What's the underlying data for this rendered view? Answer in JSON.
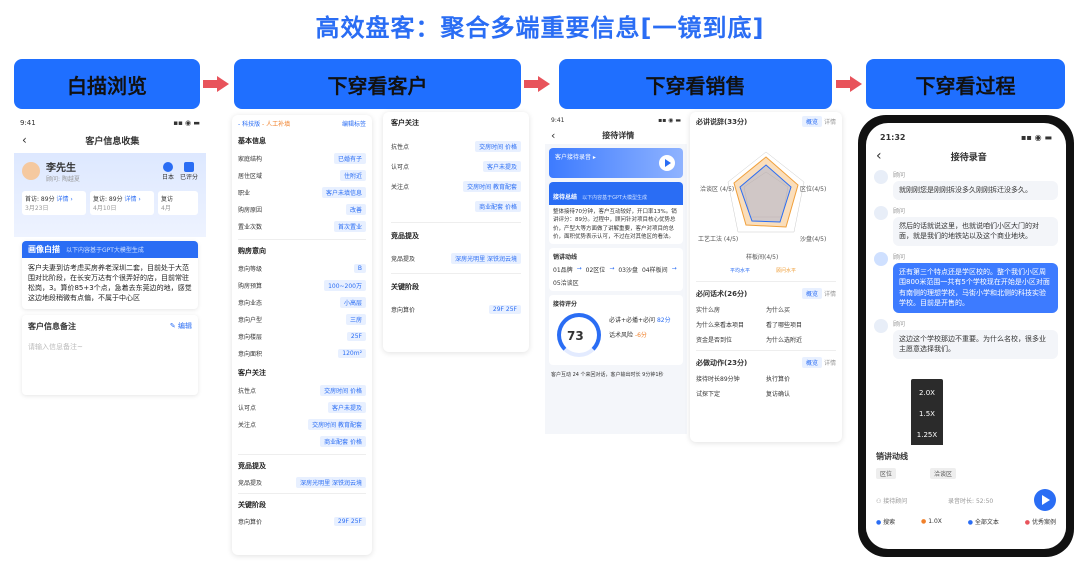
{
  "title": "高效盘客：聚合多端重要信息[一镜到底]",
  "stages": [
    "白描浏览",
    "下穿看客户",
    "下穿看销售",
    "下穿看过程"
  ],
  "p1": {
    "time": "9:41",
    "header": "客户信息收集",
    "name": "李先生",
    "role": "顾问: 陶越夏",
    "schedule": "日本",
    "icon2": "已评分",
    "visits": [
      {
        "label": "首访: 89分",
        "date": "3月23日",
        "detail": "详情 ›"
      },
      {
        "label": "复访: 89分",
        "date": "4月10日",
        "detail": "详情 ›"
      },
      {
        "label": "复访",
        "date": "4月"
      }
    ],
    "portrait_title": "画像白描",
    "portrait_sub": "以下内容基于GPT大模型生成",
    "portrait_text": "客户夫妻到访考虑买房养老深圳二套，目前处于大范围对比阶段，在长安万达有个很弄好的店，目前常驻松岗，3。算价85+3个点，急着去东莞边的地，感觉这边地段稍微有点偏，不属于中心区",
    "remark_title": "客户信息备注",
    "remark_edit": "编辑",
    "remark_ph": "请输入信息备注~"
  },
  "p2": {
    "legend": [
      "- 科技版",
      "- 人工补填"
    ],
    "edit": "编辑标签",
    "basic": "基本信息",
    "rows1": [
      [
        "家庭结构",
        "已婚有子"
      ],
      [
        "居住区域",
        "住附近"
      ],
      [
        "职业",
        "客户未填信息"
      ],
      [
        "购房原因",
        "改善"
      ],
      [
        "置业次数",
        "首次置业"
      ]
    ],
    "intent": "购房意向",
    "rows2": [
      [
        "意向等级",
        "B"
      ],
      [
        "购房预算",
        "100~200万"
      ],
      [
        "意向业态",
        "小高层"
      ],
      [
        "意向户型",
        "三房"
      ],
      [
        "意向楼层",
        "25F"
      ],
      [
        "意向面积",
        "120m²"
      ]
    ],
    "focus": "客户关注",
    "rows3": [
      [
        "抗性点",
        "交房时间  价格"
      ],
      [
        "认可点",
        "客户未提及"
      ],
      [
        "关注点",
        "交房时间 教育配套"
      ],
      [
        "",
        "商业配套  价格"
      ]
    ],
    "comp": "竞品提及",
    "comp_row": [
      "竞品提及",
      "深房光明里  深铁润云境"
    ],
    "stage": "关键阶段",
    "stage_row": [
      "意向算价",
      "29F  25F"
    ]
  },
  "p2b": {
    "focus": "客户关注",
    "rows": [
      [
        "抗性点",
        "交房时间  价格"
      ],
      [
        "认可点",
        "客户未提及"
      ],
      [
        "关注点",
        "交房时间  教育配套"
      ],
      [
        "",
        "商业配套  价格"
      ]
    ],
    "comp": "竞品提及",
    "comp_row": [
      "竞品提及",
      "深房光明里  深铁润云境"
    ],
    "stage": "关键阶段",
    "stage_row": [
      "意向算价",
      "29F  25F"
    ]
  },
  "p3": {
    "time": "9:41",
    "header": "接待详情",
    "audio": "客户接待录音 ▸",
    "summary_title": "接待总结",
    "summary_sub": "以下内容基于GPT大模型生成",
    "summary": "整体接待70分钟，客户互动较好，开口率13%。销讲评分：89分。过程中，顾问针对项目核心优势总价，产型大等方面做了讲解重要，客户对项目的总价，面积优势表示认可，不过在对其他区的看法。",
    "flow_title": "销讲动线",
    "flow": [
      "01品牌",
      "02区位",
      "03沙盘",
      "04样板间",
      "05洽谈区"
    ],
    "score_title": "接待评分",
    "score": "73",
    "score_label": "得分",
    "score_items": [
      [
        "必讲+必播+必问",
        "82分"
      ],
      [
        "话术风险",
        "-6分"
      ]
    ],
    "footer": "客户互动 24 个来回对话，客户输出时长 9分钟1秒"
  },
  "p4": {
    "title": "必讲说辞(33分)",
    "tabs": [
      "概览",
      "详情"
    ],
    "radar": [
      "洽谈区\n(4/5)",
      "区位(4/5)",
      "工艺工法\n(4/5)",
      "沙盘(4/5)",
      "样板间(4/5)"
    ],
    "legend": [
      "平均水平",
      "顾问水平"
    ],
    "ask_title": "必问话术(26分)",
    "ask": [
      [
        "实什么房",
        "为什么买"
      ],
      [
        "为什么来看本项目",
        "看了哪些项目"
      ],
      [
        "资金是否到位",
        "为什么选附近"
      ]
    ],
    "act_title": "必做动作(23分)",
    "act": [
      [
        "接待时长89分钟",
        "执行算价"
      ],
      [
        "试探下定",
        "复访确认"
      ]
    ]
  },
  "p5": {
    "time": "21:32",
    "header": "接待录音",
    "advisor": "顾问",
    "msgs": [
      "就刚刚您是刚刚拆没多久刚刚拆迁没多久。",
      "然后的话就说这里，也就说咱们小区大门的对面，就是我们的地铁站以及这个商业地块。",
      "还有第三个特点还是学区校的。整个我们小区周围800米范围一共有5个学校现在开始是小区对面有南侧的理想学校，马街小学和北侧的科技实验学校。目前是开售的。",
      "这边这个学校那边不重要。为什么名校，很多业主愿意选择我们。"
    ],
    "speeds": [
      "2.0X",
      "1.5X",
      "1.25X",
      "1.0X",
      "0.75X",
      "0.5X"
    ],
    "talk_title": "销讲动线",
    "talk_tags": [
      "区位",
      "洽谈区"
    ],
    "input_ph": "接待顾问",
    "dur": "录音时长: 52:50",
    "bottom": [
      "搜索",
      "1.0X",
      "全部文本",
      "优秀案例"
    ]
  }
}
